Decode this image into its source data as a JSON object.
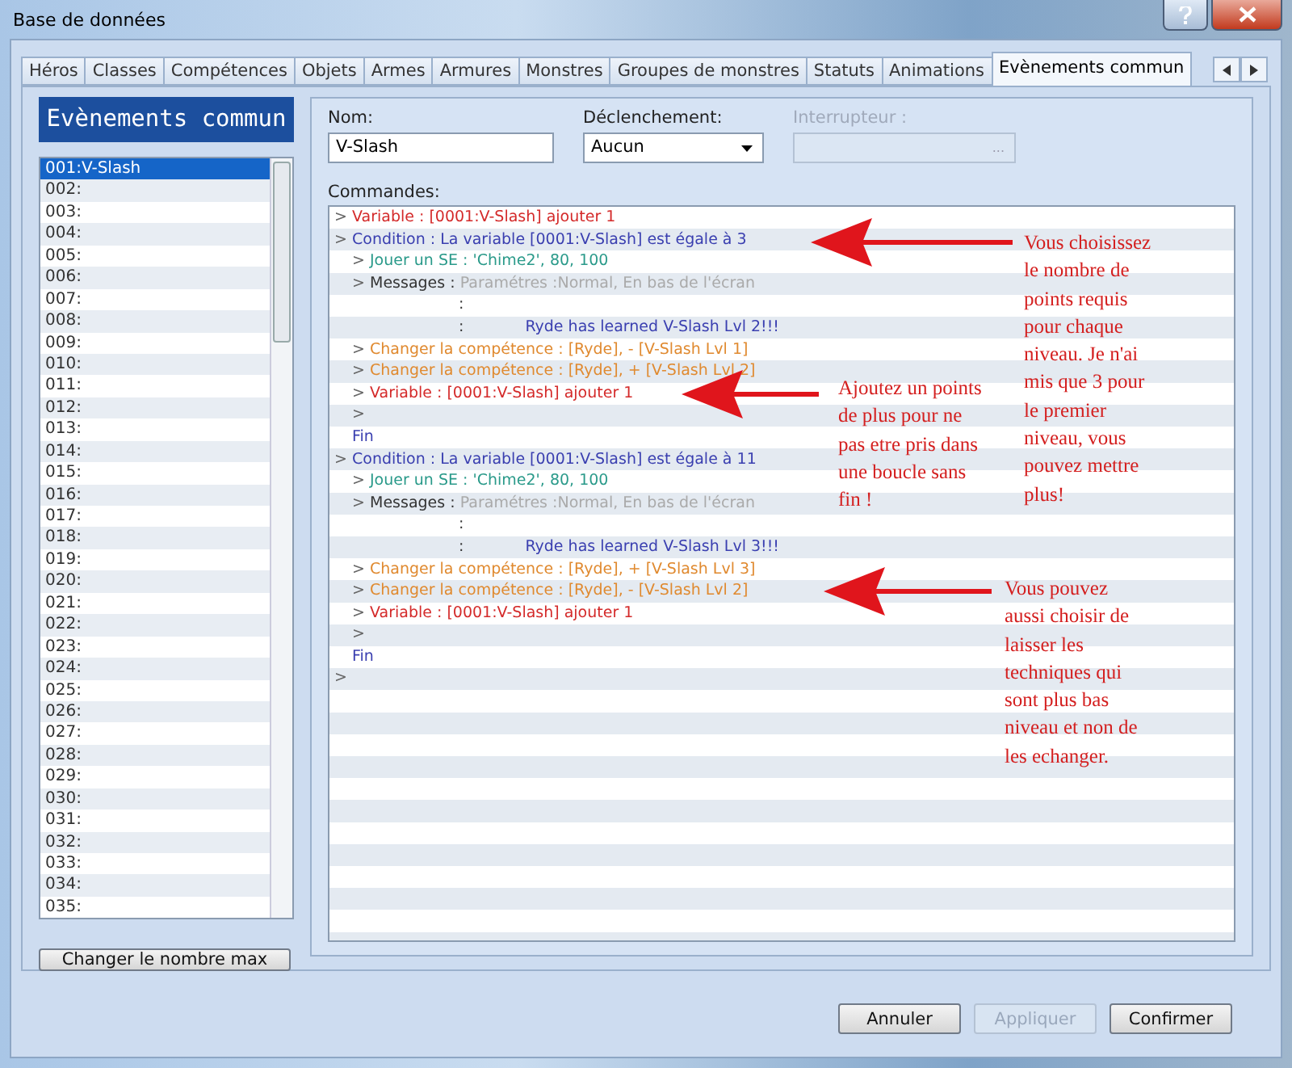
{
  "window": {
    "title": "Base de données"
  },
  "tabs": [
    {
      "label": "Héros",
      "selected": false
    },
    {
      "label": "Classes",
      "selected": false
    },
    {
      "label": "Compétences",
      "selected": false
    },
    {
      "label": "Objets",
      "selected": false
    },
    {
      "label": "Armes",
      "selected": false
    },
    {
      "label": "Armures",
      "selected": false
    },
    {
      "label": "Monstres",
      "selected": false
    },
    {
      "label": "Groupes de monstres",
      "selected": false
    },
    {
      "label": "Statuts",
      "selected": false
    },
    {
      "label": "Animations",
      "selected": false
    },
    {
      "label": "Evènements commun",
      "selected": true
    }
  ],
  "sidebar": {
    "title": "Evènements commun",
    "items": [
      {
        "label": "001:V-Slash",
        "selected": true
      },
      {
        "label": "002:",
        "selected": false
      },
      {
        "label": "003:",
        "selected": false
      },
      {
        "label": "004:",
        "selected": false
      },
      {
        "label": "005:",
        "selected": false
      },
      {
        "label": "006:",
        "selected": false
      },
      {
        "label": "007:",
        "selected": false
      },
      {
        "label": "008:",
        "selected": false
      },
      {
        "label": "009:",
        "selected": false
      },
      {
        "label": "010:",
        "selected": false
      },
      {
        "label": "011:",
        "selected": false
      },
      {
        "label": "012:",
        "selected": false
      },
      {
        "label": "013:",
        "selected": false
      },
      {
        "label": "014:",
        "selected": false
      },
      {
        "label": "015:",
        "selected": false
      },
      {
        "label": "016:",
        "selected": false
      },
      {
        "label": "017:",
        "selected": false
      },
      {
        "label": "018:",
        "selected": false
      },
      {
        "label": "019:",
        "selected": false
      },
      {
        "label": "020:",
        "selected": false
      },
      {
        "label": "021:",
        "selected": false
      },
      {
        "label": "022:",
        "selected": false
      },
      {
        "label": "023:",
        "selected": false
      },
      {
        "label": "024:",
        "selected": false
      },
      {
        "label": "025:",
        "selected": false
      },
      {
        "label": "026:",
        "selected": false
      },
      {
        "label": "027:",
        "selected": false
      },
      {
        "label": "028:",
        "selected": false
      },
      {
        "label": "029:",
        "selected": false
      },
      {
        "label": "030:",
        "selected": false
      },
      {
        "label": "031:",
        "selected": false
      },
      {
        "label": "032:",
        "selected": false
      },
      {
        "label": "033:",
        "selected": false
      },
      {
        "label": "034:",
        "selected": false
      },
      {
        "label": "035:",
        "selected": false
      }
    ],
    "button": "Changer le nombre max"
  },
  "form": {
    "name_label": "Nom:",
    "name_value": "V-Slash",
    "trigger_label": "Déclenchement:",
    "trigger_value": "Aucun",
    "switch_label": "Interrupteur :",
    "switch_button": "...",
    "switch_disabled": true,
    "commands_label": "Commandes:"
  },
  "commands": [
    {
      "kind": "variable",
      "marker": ">",
      "text": "Variable : [0001:V-Slash] ajouter 1"
    },
    {
      "kind": "condition",
      "marker": ">",
      "text": "Condition : La variable [0001:V-Slash] est égale à 3",
      "children": [
        {
          "kind": "sound",
          "marker": ">",
          "text": "Jouer un SE : 'Chime2', 80, 100"
        },
        {
          "kind": "message",
          "marker": ">",
          "text": "Messages :",
          "params": "Paramétres :Normal, En bas de l'écran",
          "lines": [
            {
              "colon": ":"
            },
            {
              "colon": ":",
              "text": "Ryde has learned V-Slash Lvl 2!!!"
            }
          ]
        },
        {
          "kind": "skill",
          "marker": ">",
          "text": "Changer la compétence : [Ryde], - [V-Slash Lvl 1]"
        },
        {
          "kind": "skill",
          "marker": ">",
          "text": "Changer la compétence : [Ryde], + [V-Slash Lvl 2]"
        },
        {
          "kind": "variable",
          "marker": ">",
          "text": "Variable : [0001:V-Slash] ajouter 1"
        },
        {
          "kind": "empty",
          "marker": ">"
        }
      ],
      "end": "Fin"
    },
    {
      "kind": "condition",
      "marker": ">",
      "text": "Condition : La variable [0001:V-Slash] est égale à 11",
      "children": [
        {
          "kind": "sound",
          "marker": ">",
          "text": "Jouer un SE : 'Chime2', 80, 100"
        },
        {
          "kind": "message",
          "marker": ">",
          "text": "Messages :",
          "params": "Paramétres :Normal, En bas de l'écran",
          "lines": [
            {
              "colon": ":"
            },
            {
              "colon": ":",
              "text": "Ryde has learned V-Slash Lvl 3!!!"
            }
          ]
        },
        {
          "kind": "skill",
          "marker": ">",
          "text": "Changer la compétence : [Ryde], + [V-Slash Lvl 3]"
        },
        {
          "kind": "skill",
          "marker": ">",
          "text": "Changer la compétence : [Ryde], - [V-Slash Lvl 2]"
        },
        {
          "kind": "variable",
          "marker": ">",
          "text": "Variable : [0001:V-Slash] ajouter 1"
        },
        {
          "kind": "empty",
          "marker": ">"
        }
      ],
      "end": "Fin"
    },
    {
      "kind": "empty",
      "marker": ">"
    }
  ],
  "annotations": [
    {
      "text": "Ajoutez un points de plus pour ne pas etre pris dans une boucle sans fin !"
    },
    {
      "text": "Vous choisissez le nombre de points requis pour chaque niveau. Je n'ai mis que 3 pour le premier niveau, vous pouvez mettre plus!"
    },
    {
      "text": "Vous pouvez aussi choisir de laisser les techniques qui sont plus bas niveau et non de les echanger."
    }
  ],
  "buttons": [
    {
      "label": "Annuler",
      "disabled": false
    },
    {
      "label": "Appliquer",
      "disabled": true
    },
    {
      "label": "Confirmer",
      "disabled": false
    }
  ]
}
